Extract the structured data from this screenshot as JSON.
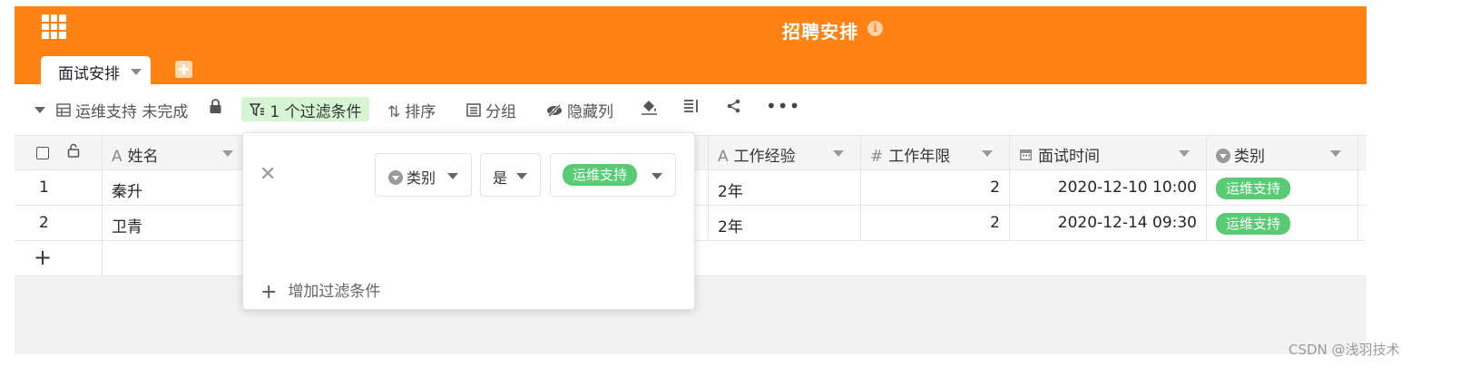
{
  "app": {
    "title": "招聘安排",
    "info_icon": "i",
    "tabs": [
      {
        "label": "面试安排"
      }
    ],
    "add_tab_icon": "plus-icon"
  },
  "toolbar": {
    "view_name": "运维支持 未完成",
    "filter_chip": "1 个过滤条件",
    "sort": "排序",
    "group": "分组",
    "hide_columns": "隐藏列"
  },
  "table": {
    "columns": [
      "姓名",
      "工作经验",
      "工作年限",
      "面试时间",
      "类别"
    ],
    "column_icons": [
      "A",
      "A",
      "#",
      "calendar",
      "single-select"
    ],
    "rows": [
      {
        "index": "1",
        "name": "秦升",
        "experience": "2年",
        "years": "2",
        "interview_time": "2020-12-10 10:00",
        "category": "运维支持"
      },
      {
        "index": "2",
        "name": "卫青",
        "experience": "2年",
        "years": "2",
        "interview_time": "2020-12-14 09:30",
        "category": "运维支持"
      }
    ],
    "add_row": "+"
  },
  "filter_panel": {
    "field": "类别",
    "operator": "是",
    "value": "运维支持",
    "add_condition": "增加过滤条件"
  },
  "watermark": "CSDN @浅羽技术",
  "colors": {
    "header": "#ff8214",
    "tag": "#59cb74",
    "filter_chip_bg": "#d6f5d3"
  }
}
